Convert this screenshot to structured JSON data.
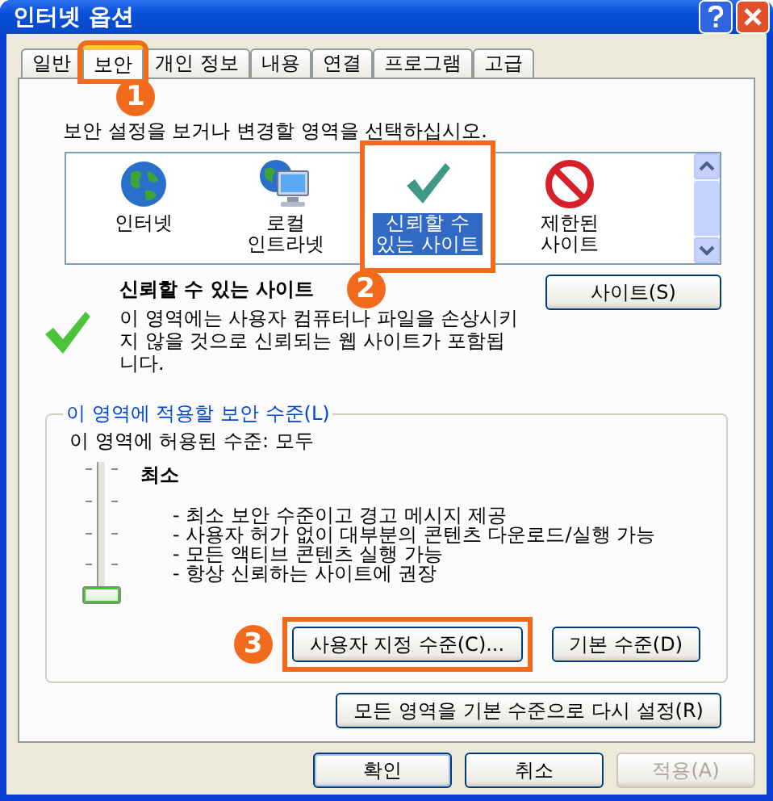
{
  "window": {
    "title": "인터넷 옵션"
  },
  "tabs": [
    {
      "label": "일반",
      "selected": false,
      "highlighted": false
    },
    {
      "label": "보안",
      "selected": true,
      "highlighted": true
    },
    {
      "label": "개인 정보",
      "selected": false,
      "highlighted": false
    },
    {
      "label": "내용",
      "selected": false,
      "highlighted": false
    },
    {
      "label": "연결",
      "selected": false,
      "highlighted": false
    },
    {
      "label": "프로그램",
      "selected": false,
      "highlighted": false
    },
    {
      "label": "고급",
      "selected": false,
      "highlighted": false
    }
  ],
  "callouts": [
    "1",
    "2",
    "3"
  ],
  "instruction": "보안 설정을 보거나 변경할 영역을 선택하십시오.",
  "zones": [
    {
      "label": "인터넷",
      "kind": "globe",
      "selected": false,
      "highlighted": false
    },
    {
      "label": "로컬\n인트라넷",
      "kind": "globe-monitor",
      "selected": false,
      "highlighted": false
    },
    {
      "label": "신뢰할 수\n있는 사이트",
      "kind": "check",
      "selected": true,
      "highlighted": true
    },
    {
      "label": "제한된\n사이트",
      "kind": "forbidden",
      "selected": false,
      "highlighted": false
    }
  ],
  "zone_info": {
    "title": "신뢰할 수 있는 사이트",
    "description": "이 영역에는 사용자 컴퓨터나 파일을 손상시키지 않을 것으로 신뢰되는 웹 사이트가 포함됩니다.",
    "button": "사이트(S)"
  },
  "security_level": {
    "group_title": "이 영역에 적용할 보안 수준(L)",
    "allowed": "이 영역에 허용된 수준: 모두",
    "level_name": "최소",
    "bullets": [
      "- 최소 보안 수준이고 경고 메시지 제공",
      "- 사용자 허가 없이 대부분의 콘텐츠 다운로드/실행 가능",
      "- 모든 액티브 콘텐츠 실행 가능",
      "- 항상 신뢰하는 사이트에 권장"
    ],
    "slider": {
      "level": 0
    },
    "buttons": [
      {
        "label": "사용자 지정 수준(C)...",
        "highlighted": true
      },
      {
        "label": "기본 수준(D)",
        "highlighted": false
      }
    ]
  },
  "reset_button": "모든 영역을 기본 수준으로 다시 설정(R)",
  "footer_buttons": [
    {
      "label": "확인",
      "default": true,
      "disabled": false
    },
    {
      "label": "취소",
      "default": false,
      "disabled": false
    },
    {
      "label": "적용(A)",
      "default": false,
      "disabled": true
    }
  ]
}
